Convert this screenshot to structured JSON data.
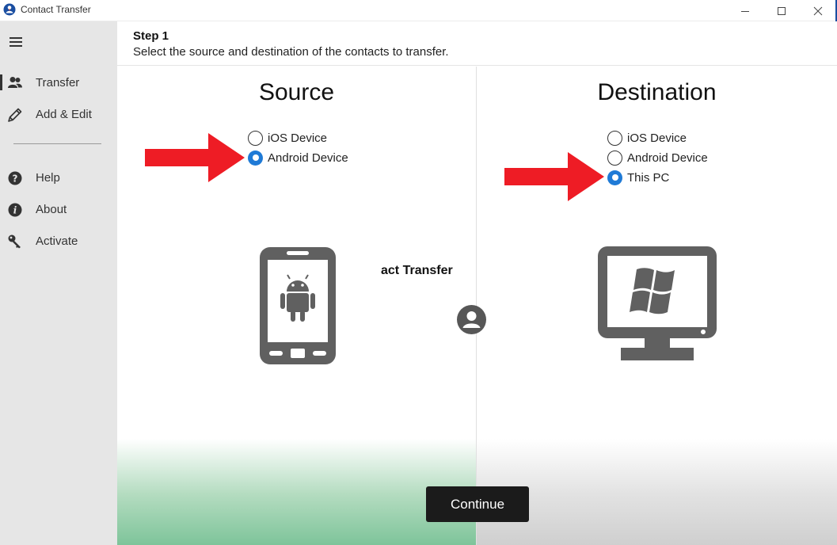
{
  "window": {
    "title": "Contact Transfer",
    "controls": {
      "minimize": "minimize-icon",
      "maximize": "maximize-icon",
      "close": "close-icon"
    }
  },
  "sidebar": {
    "menu_icon": "hamburger-icon",
    "items": [
      {
        "label": "Transfer",
        "icon": "people-icon",
        "active": true
      },
      {
        "label": "Add & Edit",
        "icon": "pencil-icon"
      },
      {
        "label": "Help",
        "icon": "question-icon"
      },
      {
        "label": "About",
        "icon": "info-icon"
      },
      {
        "label": "Activate",
        "icon": "key-icon"
      }
    ]
  },
  "header": {
    "step": "Step 1",
    "description": "Select the source and destination of the contacts to transfer."
  },
  "source": {
    "title": "Source",
    "options": [
      {
        "label": "iOS Device",
        "checked": false
      },
      {
        "label": "Android Device",
        "checked": true
      }
    ],
    "device_icon": "android-phone-icon"
  },
  "destination": {
    "title": "Destination",
    "options": [
      {
        "label": "iOS Device",
        "checked": false
      },
      {
        "label": "Android Device",
        "checked": false
      },
      {
        "label": "This PC",
        "checked": true
      }
    ],
    "device_icon": "windows-pc-icon"
  },
  "overlay_text": "act Transfer",
  "center_icon": "contact-person-icon",
  "continue_label": "Continue",
  "colors": {
    "accent": "#1f7ad6",
    "arrow": "#ee1c25",
    "device_gray": "#606060",
    "button": "#1b1b1b",
    "source_gradient": "#7ec49a"
  }
}
